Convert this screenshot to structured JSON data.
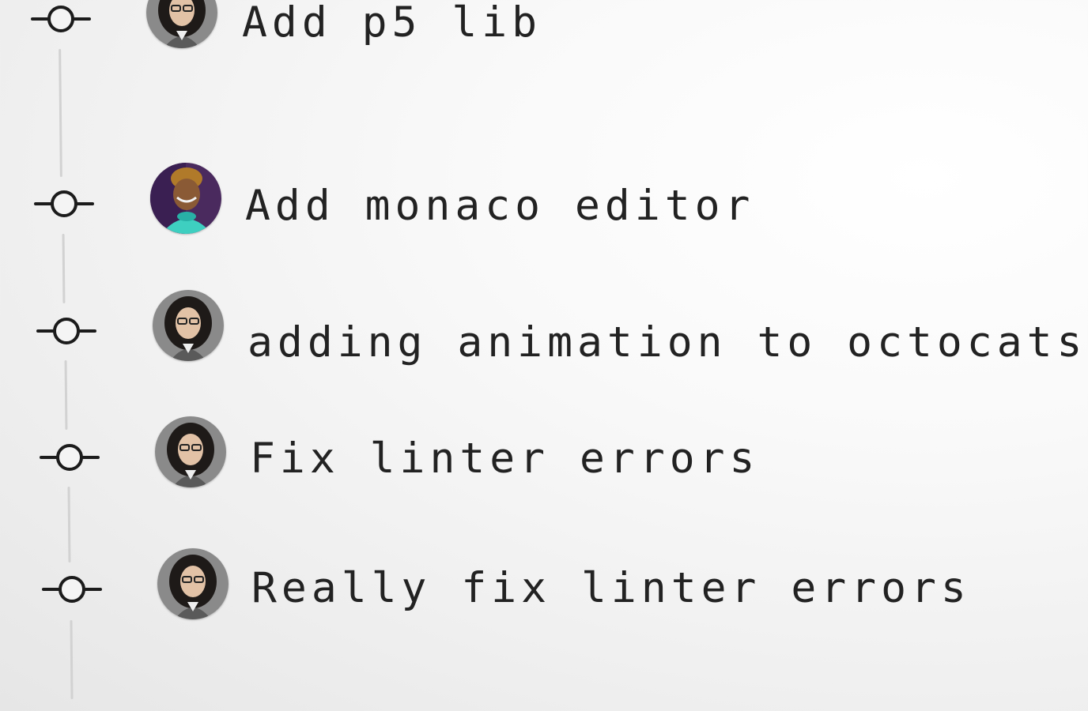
{
  "commits": [
    {
      "message": "Add p5 lib",
      "author_avatar": "avatar-woman-glasses"
    },
    {
      "message": "Add monaco editor",
      "author_avatar": "avatar-woman-purple"
    },
    {
      "message": "adding animation to octocats",
      "author_avatar": "avatar-woman-glasses",
      "emoji": "dancing-cats-emoji"
    },
    {
      "message": "Fix linter errors",
      "author_avatar": "avatar-woman-glasses"
    },
    {
      "message": "Really fix linter errors",
      "author_avatar": "avatar-woman-glasses"
    }
  ],
  "colors": {
    "text": "#222222",
    "node": "#1b1b1b",
    "line": "#d2d2d2"
  },
  "icons": {
    "commit_node": "commit-node-icon",
    "dancing_cats": "dancing-cats-emoji"
  }
}
